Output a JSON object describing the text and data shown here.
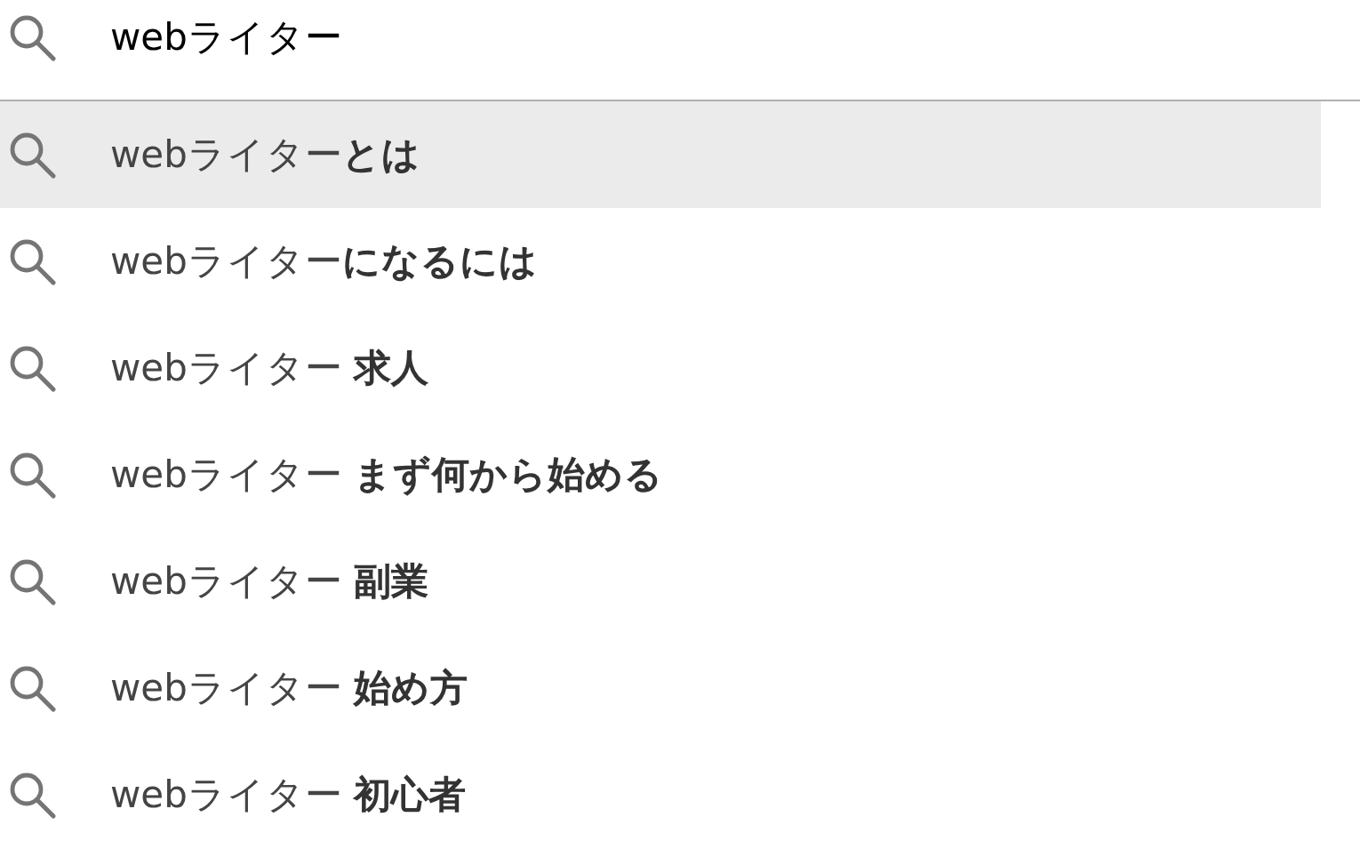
{
  "search": {
    "value": "webライター"
  },
  "suggestions": [
    {
      "text": "webライター**とは**",
      "selected": true
    },
    {
      "text": "webライター**になるには**",
      "selected": false
    },
    {
      "text": "webライター **求人**",
      "selected": false
    },
    {
      "text": "webライター **まず何から始める**",
      "selected": false
    },
    {
      "text": "webライター **副業**",
      "selected": false
    },
    {
      "text": "webライター **始め方**",
      "selected": false
    },
    {
      "text": "webライター **初心者**",
      "selected": false
    }
  ]
}
